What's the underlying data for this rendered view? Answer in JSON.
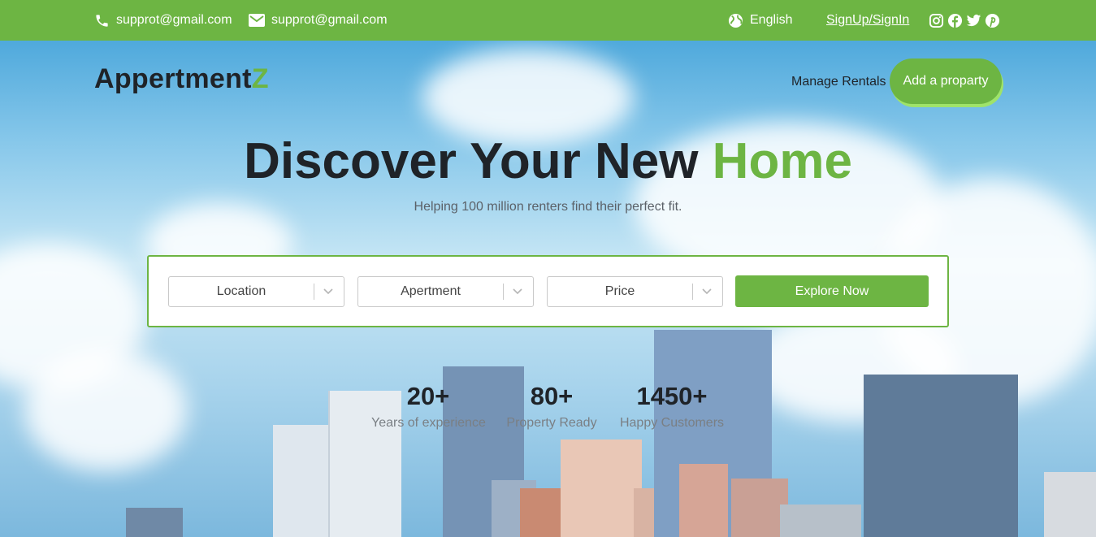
{
  "topbar": {
    "phone_email": "supprot@gmail.com",
    "mail_email": "supprot@gmail.com",
    "language": "English",
    "auth_link": "SignUp/SignIn",
    "socials": [
      "instagram-icon",
      "facebook-icon",
      "twitter-icon",
      "pinterest-icon"
    ]
  },
  "brand": {
    "name_main": "Appertment",
    "name_accent": "Z"
  },
  "nav": {
    "manage": "Manage Rentals",
    "add": "Add a proparty"
  },
  "hero": {
    "title_main": "Discover Your New",
    "title_accent": "Home",
    "subtitle": "Helping 100 million renters find their perfect fit."
  },
  "search": {
    "location": "Location",
    "type": "Apertment",
    "price": "Price",
    "button": "Explore Now"
  },
  "stats": [
    {
      "value": "20+",
      "label": "Years of experience"
    },
    {
      "value": "80+",
      "label": "Property Ready"
    },
    {
      "value": "1450+",
      "label": "Happy Customers"
    }
  ],
  "colors": {
    "accent": "#6db543",
    "text": "#1f2328"
  }
}
